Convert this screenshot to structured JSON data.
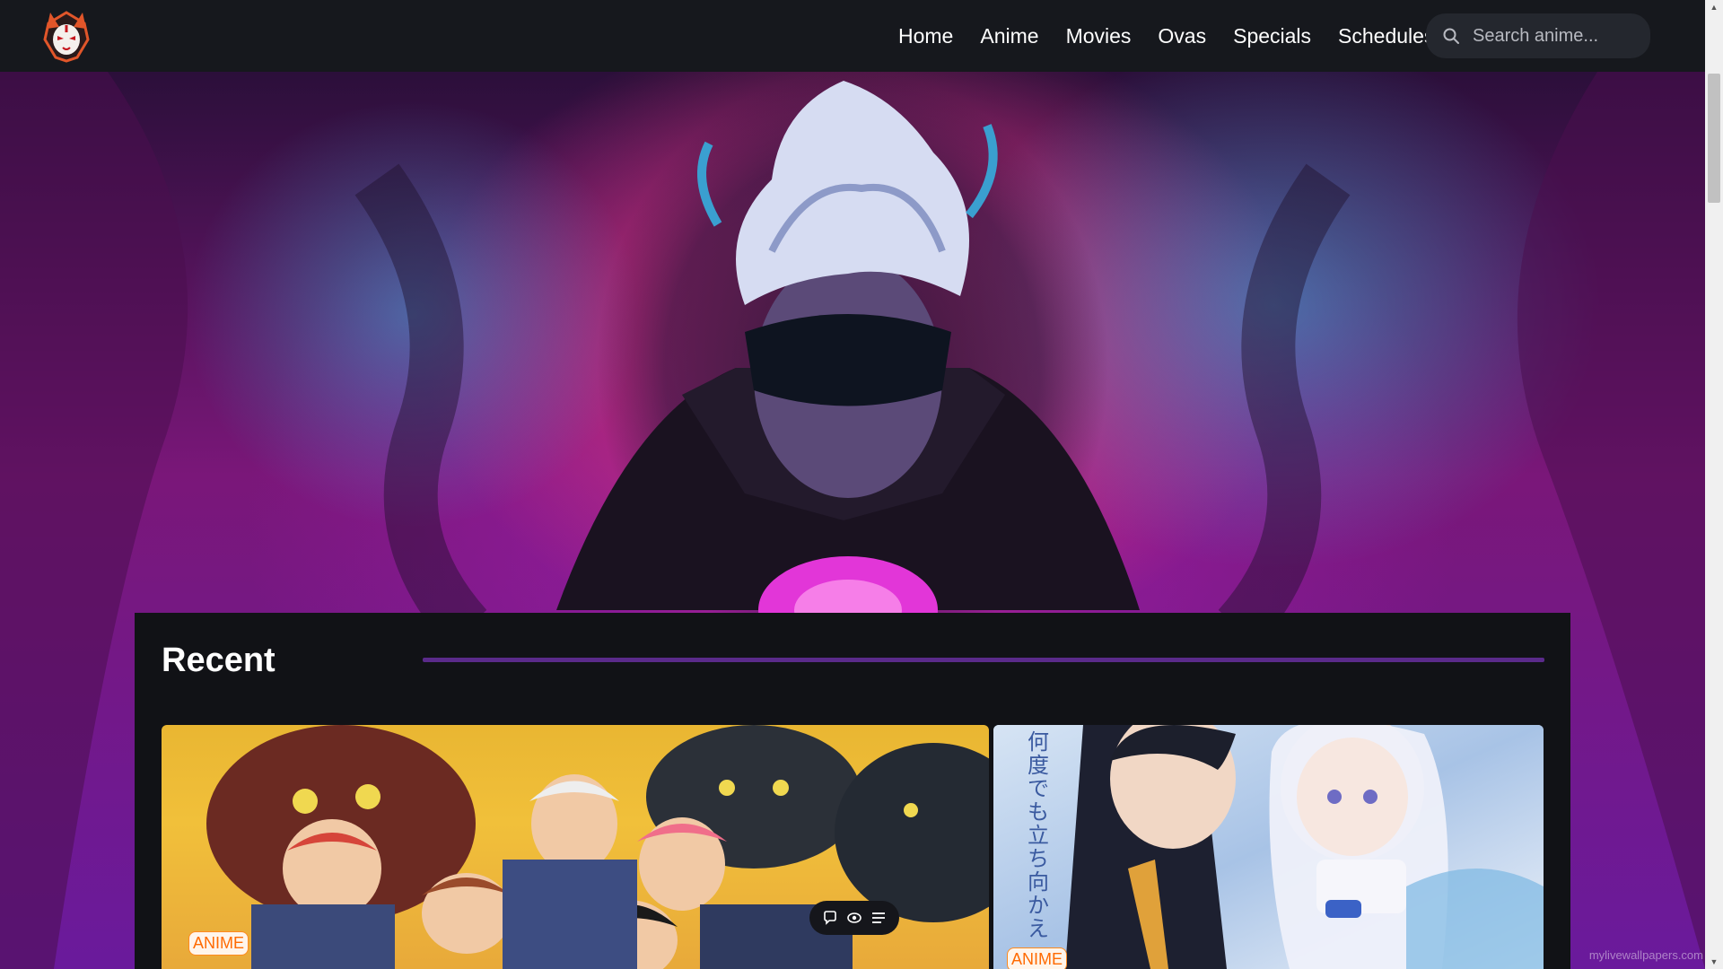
{
  "nav": {
    "links": [
      "Home",
      "Anime",
      "Movies",
      "Ovas",
      "Specials",
      "Schedules"
    ],
    "search_placeholder": "Search anime..."
  },
  "recent": {
    "title": "Recent",
    "cards": [
      {
        "badge": "ANIME",
        "actions": [
          "comment-icon",
          "eye-icon",
          "list-icon"
        ]
      },
      {
        "badge": "ANIME",
        "poster_text": "何度でも立ち向かえ"
      }
    ]
  },
  "watermark": "mylivewallpapers.com",
  "colors": {
    "navbar": "#16181d",
    "panel": "#111216",
    "accent_line": "#5a2a8a",
    "badge": "#ff6a00"
  }
}
